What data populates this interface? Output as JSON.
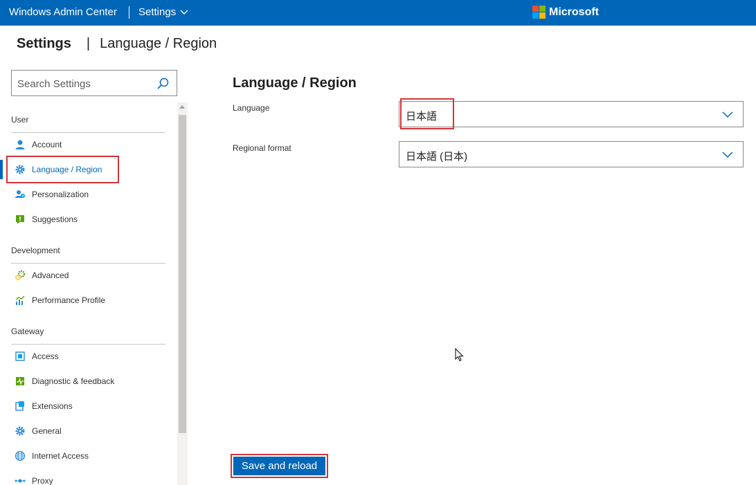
{
  "topbar": {
    "app_title": "Windows Admin Center",
    "settings_menu": "Settings",
    "brand": "Microsoft",
    "brand_colors": [
      "#f25022",
      "#7fba00",
      "#00a4ef",
      "#ffb900"
    ]
  },
  "header": {
    "title": "Settings",
    "separator": "|",
    "subtitle": "Language / Region"
  },
  "search": {
    "placeholder": "Search Settings"
  },
  "sidebar": {
    "groups": [
      {
        "label": "User",
        "items": [
          {
            "label": "Account",
            "icon": "account-icon"
          },
          {
            "label": "Language / Region",
            "icon": "gear-icon",
            "active": true
          },
          {
            "label": "Personalization",
            "icon": "personalization-icon"
          },
          {
            "label": "Suggestions",
            "icon": "suggestions-icon"
          }
        ]
      },
      {
        "label": "Development",
        "items": [
          {
            "label": "Advanced",
            "icon": "advanced-gears-icon"
          },
          {
            "label": "Performance Profile",
            "icon": "performance-chart-icon"
          }
        ]
      },
      {
        "label": "Gateway",
        "items": [
          {
            "label": "Access",
            "icon": "access-icon"
          },
          {
            "label": "Diagnostic & feedback",
            "icon": "diagnostic-icon"
          },
          {
            "label": "Extensions",
            "icon": "extensions-icon"
          },
          {
            "label": "General",
            "icon": "gear-icon"
          },
          {
            "label": "Internet Access",
            "icon": "globe-icon"
          },
          {
            "label": "Proxy",
            "icon": "proxy-icon"
          }
        ]
      }
    ]
  },
  "main": {
    "title": "Language / Region",
    "language_label": "Language",
    "language_value": "日本語",
    "regional_label": "Regional format",
    "regional_value": "日本語 (日本)",
    "save_label": "Save and reload"
  },
  "colors": {
    "accent": "#0067b8",
    "highlight": "#d13438"
  }
}
